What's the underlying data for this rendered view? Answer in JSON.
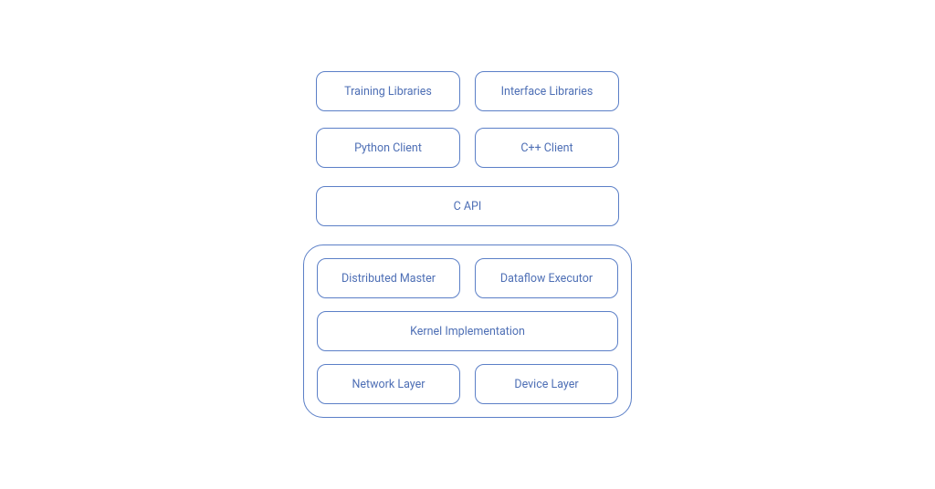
{
  "layers": {
    "training_libraries": "Training Libraries",
    "interface_libraries": "Interface Libraries",
    "python_client": "Python Client",
    "cpp_client": "C++ Client",
    "c_api": "C API",
    "distributed_master": "Distributed Master",
    "dataflow_executor": "Dataflow Executor",
    "kernel_implementation": "Kernel Implementation",
    "network_layer": "Network Layer",
    "device_layer": "Device Layer"
  },
  "colors": {
    "border": "#5b7fc7",
    "text": "#4e6fb5",
    "background": "#ffffff"
  }
}
